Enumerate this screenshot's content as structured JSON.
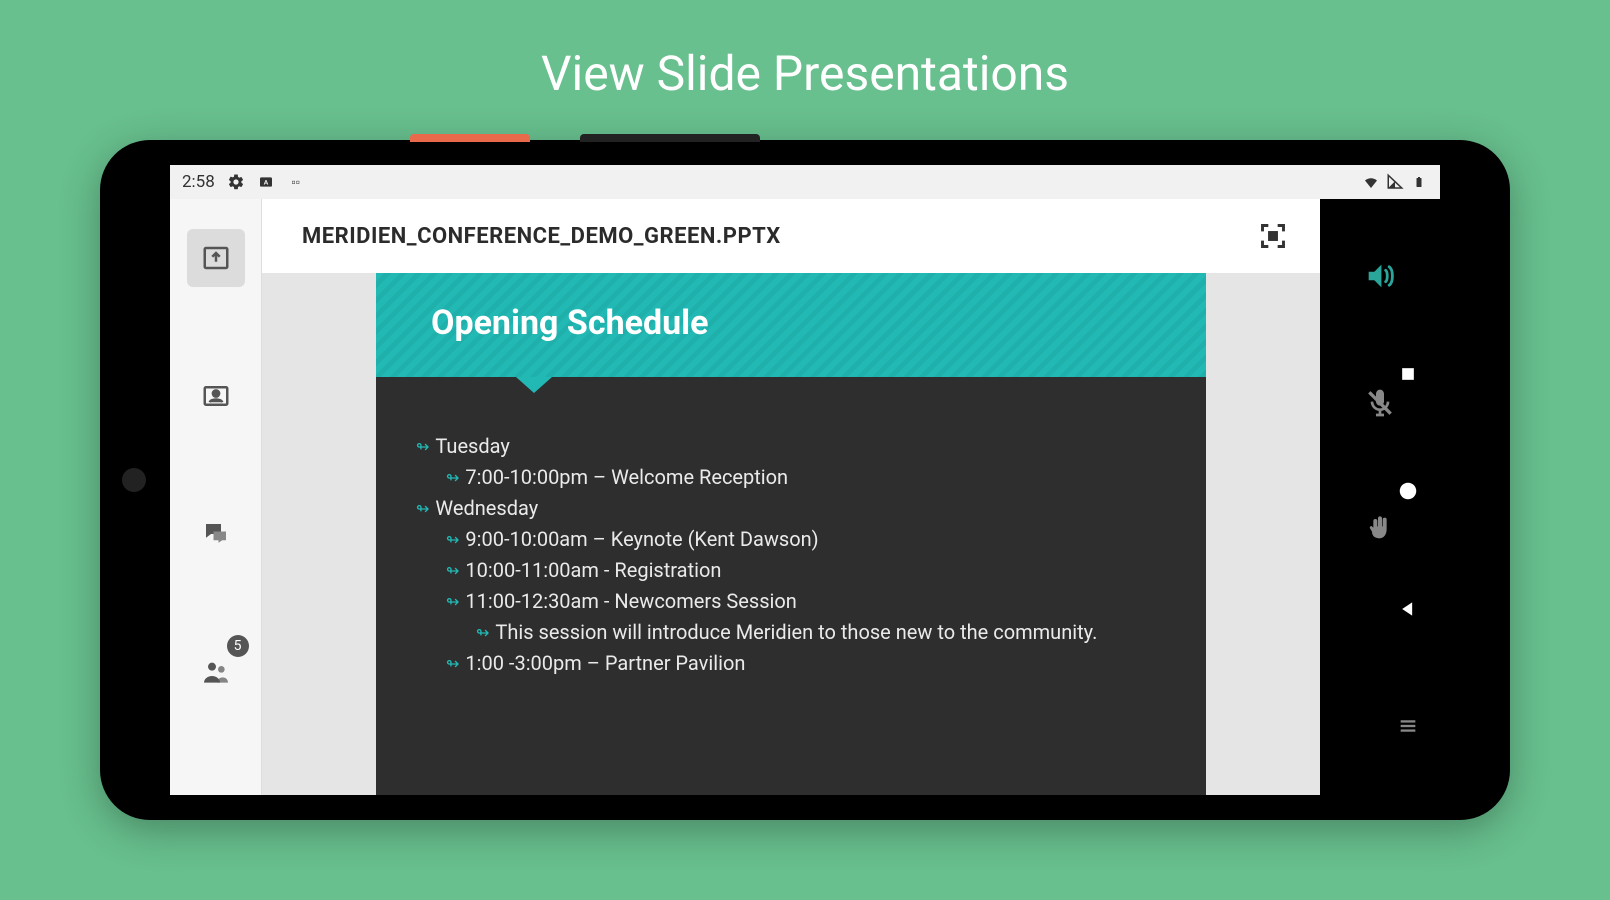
{
  "page_title": "View Slide Presentations",
  "status_bar": {
    "time": "2:58"
  },
  "left_rail": {
    "badge_count": "5"
  },
  "file": {
    "name": "MERIDIEN_CONFERENCE_DEMO_GREEN.PPTX"
  },
  "slide": {
    "title": "Opening Schedule",
    "items": [
      {
        "indent": 1,
        "text": "Tuesday"
      },
      {
        "indent": 2,
        "text": "7:00-10:00pm – Welcome Reception"
      },
      {
        "indent": 1,
        "text": "Wednesday"
      },
      {
        "indent": 2,
        "text": "9:00-10:00am – Keynote (Kent Dawson)"
      },
      {
        "indent": 2,
        "text": "10:00-11:00am - Registration"
      },
      {
        "indent": 2,
        "text": "11:00-12:30am - Newcomers Session"
      },
      {
        "indent": 3,
        "text": "This session will introduce Meridien to those new to the community."
      },
      {
        "indent": 2,
        "text": "1:00 -3:00pm – Partner Pavilion"
      }
    ]
  }
}
